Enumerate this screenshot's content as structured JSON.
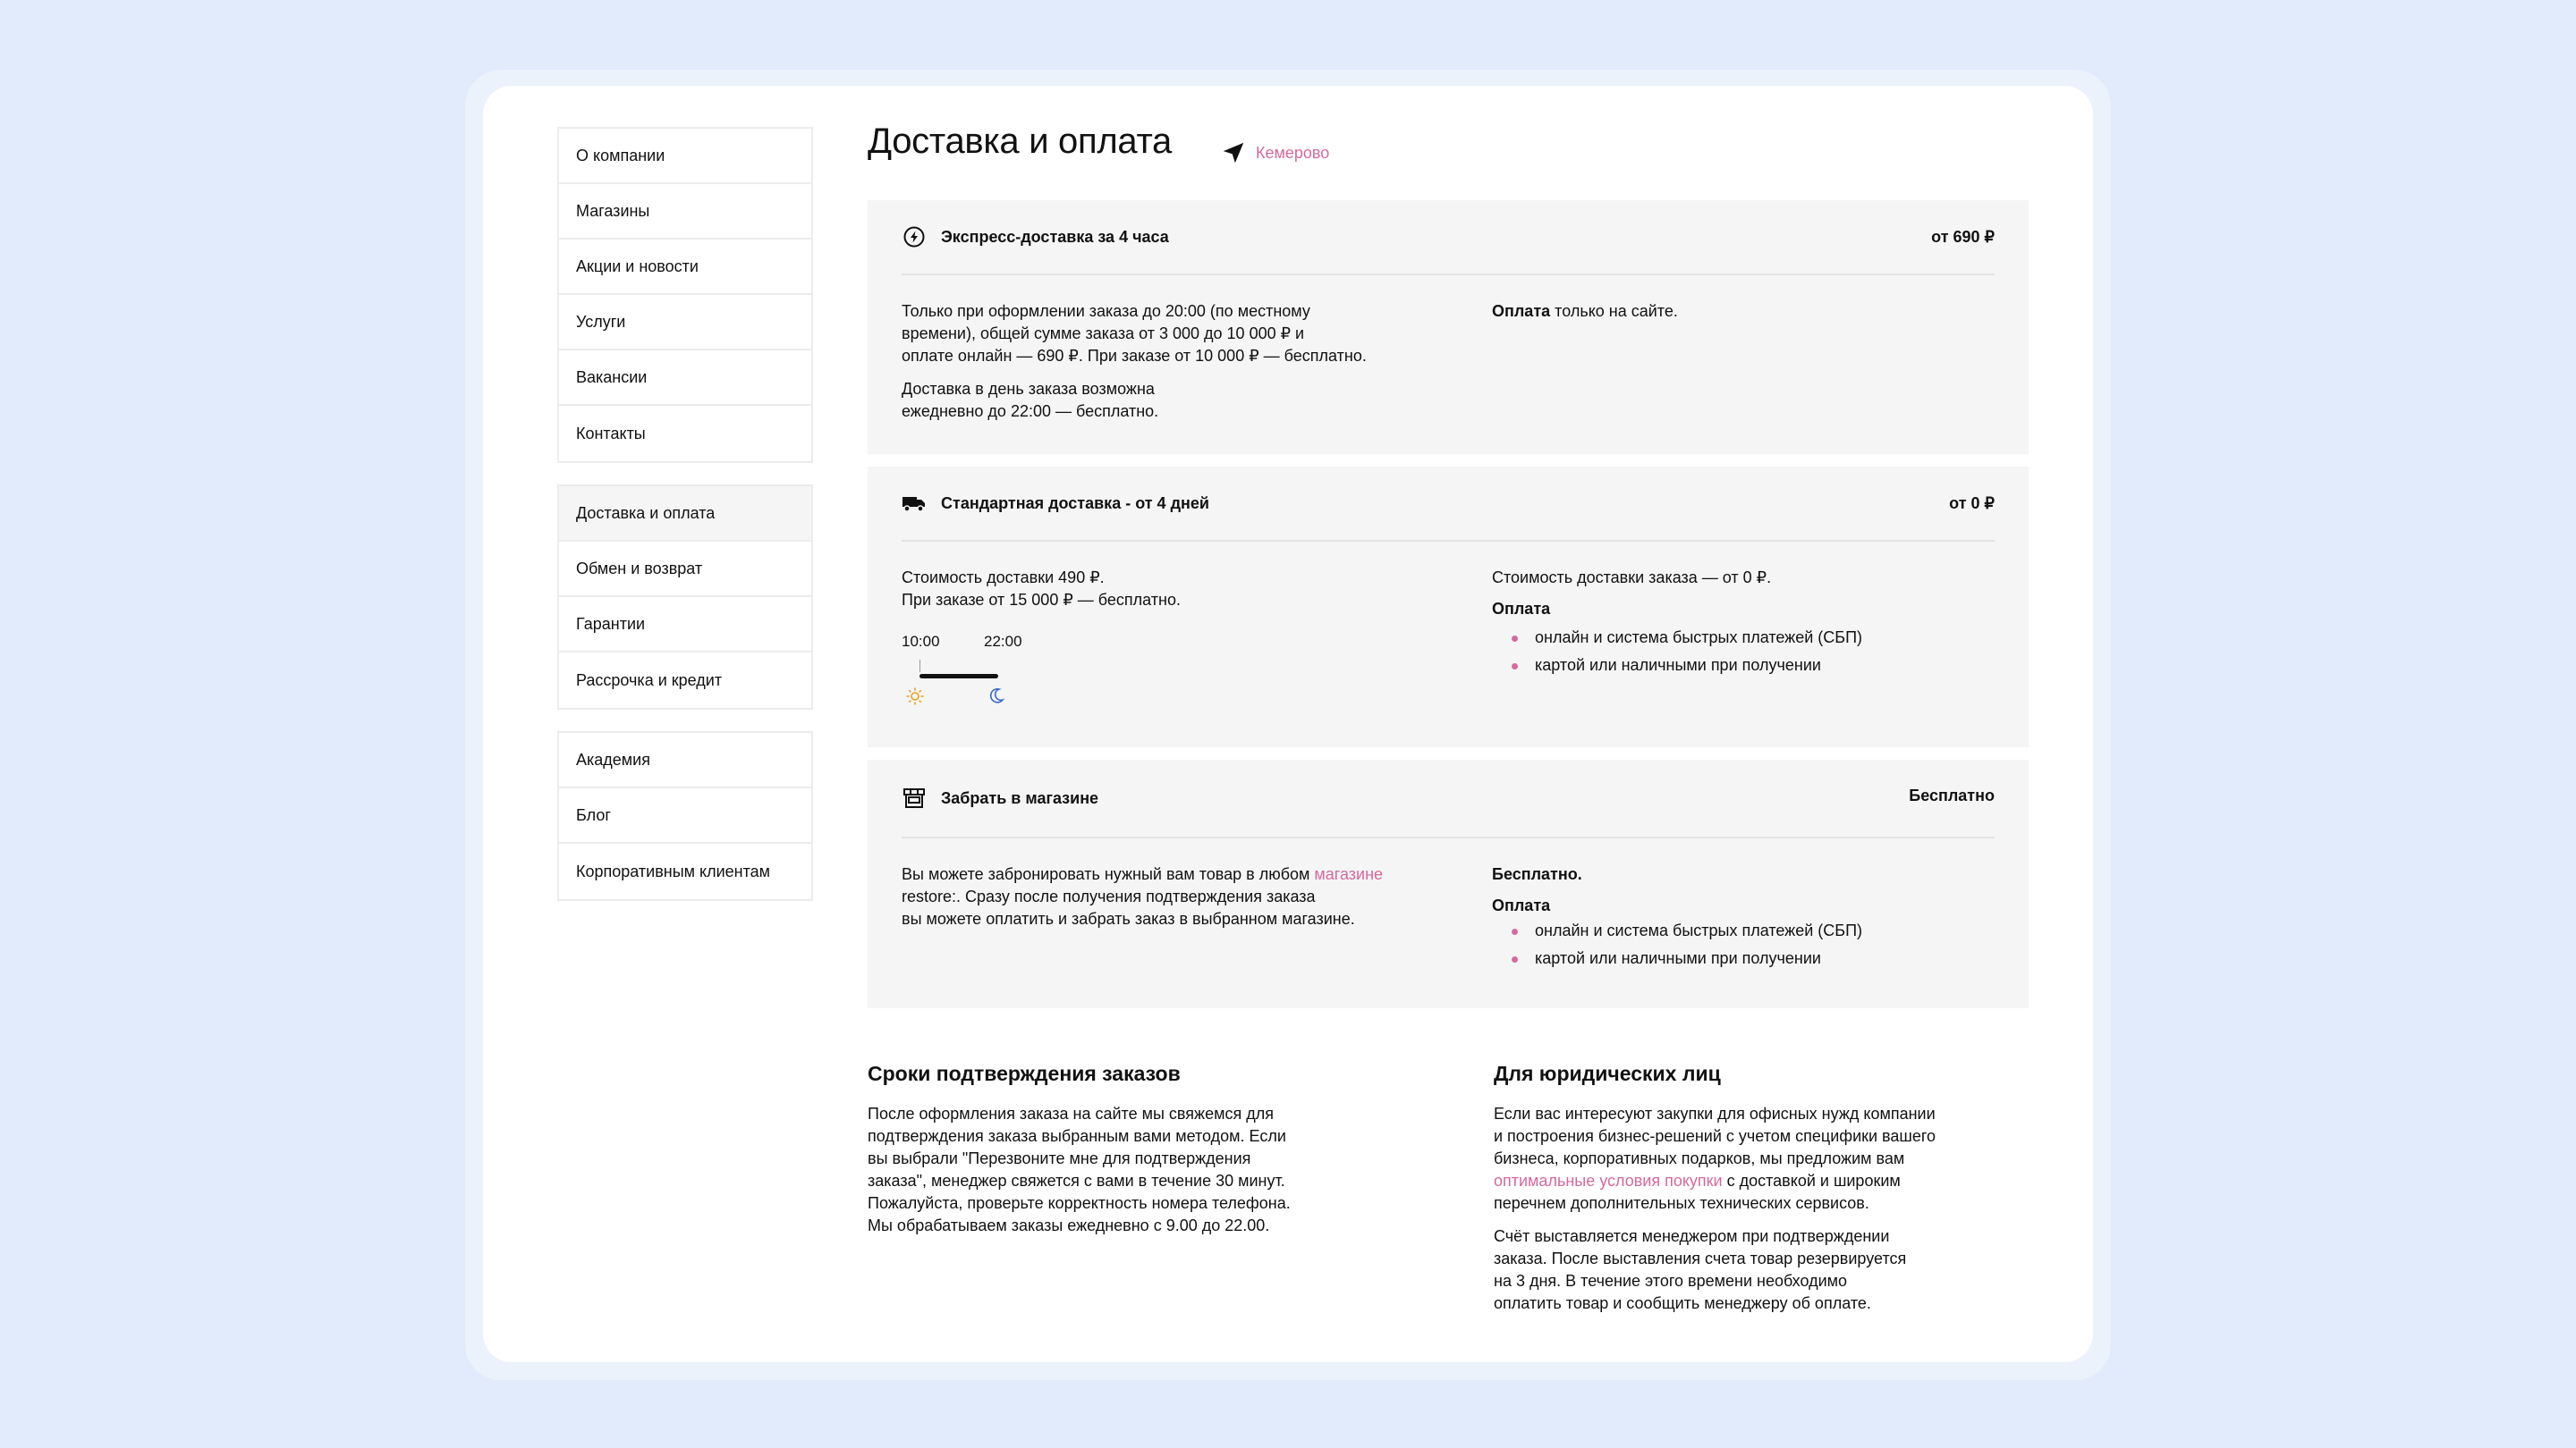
{
  "sidebar": {
    "group1": [
      "О компании",
      "Магазины",
      "Акции и новости",
      "Услуги",
      "Вакансии",
      "Контакты"
    ],
    "group2": [
      "Доставка и оплата",
      "Обмен и возврат",
      "Гарантии",
      "Рассрочка и кредит"
    ],
    "group3": [
      "Академия",
      "Блог",
      "Корпоративным клиентам"
    ],
    "active": "Доставка и оплата"
  },
  "header": {
    "title": "Доставка и оплата",
    "city": "Кемерово",
    "city_icon": "location-arrow-icon"
  },
  "express": {
    "icon": "lightning-icon",
    "title": "Экспресс-доставка за 4 часа",
    "price": "от 690 ₽",
    "left_p1_line1": "Только при оформлении заказа до 20:00 (по местному",
    "left_p1_line2": "времени), общей сумме заказа от 3 000 до 10 000 ₽ и",
    "left_p1_line3": "оплате онлайн — 690 ₽. При заказе от 10 000 ₽ — бесплатно.",
    "left_p2_line1": "Доставка в день заказа возможна",
    "left_p2_line2": "ежедневно до 22:00 — бесплатно.",
    "right_bold": "Оплата",
    "right_rest": " только на сайте."
  },
  "standard": {
    "icon": "truck-icon",
    "title": "Стандартная доставка - от 4 дней",
    "price": "от 0 ₽",
    "left_line1": "Стоимость доставки 490 ₽.",
    "left_line2": "При заказе от 15 000 ₽ — бесплатно.",
    "time_from": "10:00",
    "time_to": "22:00",
    "right_line1": "Стоимость доставки заказа — от 0 ₽.",
    "pay_label": "Оплата",
    "pay_items": [
      "онлайн и система быстрых платежей (СБП)",
      "картой или наличными при получении"
    ]
  },
  "pickup": {
    "icon": "store-icon",
    "title": "Забрать в магазине",
    "price": "Бесплатно",
    "left_line1_a": "Вы можете забронировать нужный вам товар в любом ",
    "left_line1_link": "магазине",
    "left_line2": "restore:. Сразу после получения подтверждения заказа",
    "left_line3": "вы можете оплатить и забрать заказ в выбранном магазине.",
    "right_bold": "Бесплатно.",
    "pay_label": "Оплата",
    "pay_items": [
      "онлайн и система быстрых платежей (СБП)",
      "картой или наличными при получении"
    ]
  },
  "confirm": {
    "title": "Сроки подтверждения заказов",
    "lines": [
      "После оформления заказа на сайте мы свяжемся для",
      "подтверждения заказа выбранным вами методом. Если",
      "вы выбрали \"Перезвоните мне для подтверждения",
      "заказа\", менеджер свяжется с вами в течение 30 минут.",
      "Пожалуйста, проверьте корректность номера телефона.",
      "Мы обрабатываем заказы ежедневно с 9.00 до 22.00."
    ]
  },
  "legal": {
    "title": "Для юридических лиц",
    "p1_line1": "Если вас интересуют закупки для офисных нужд компании",
    "p1_line2": "и построения бизнес-решений с учетом специфики вашего",
    "p1_line3": "бизнеса, корпоративных подарков, мы предложим вам",
    "p1_link": "оптимальные условия покупки",
    "p1_line4_rest": " с доставкой и широким",
    "p1_line5": "перечнем дополнительных технических сервисов.",
    "p2_lines": [
      "Счёт выставляется менеджером при подтверждении",
      "заказа. После выставления счета товар резервируется",
      "на 3 дня. В течение этого времени необходимо",
      "оплатить товар и сообщить менеджеру об оплате."
    ]
  },
  "colors": {
    "accent": "#d46a9e",
    "background": "#e1ebfb",
    "card": "#f5f5f5"
  }
}
